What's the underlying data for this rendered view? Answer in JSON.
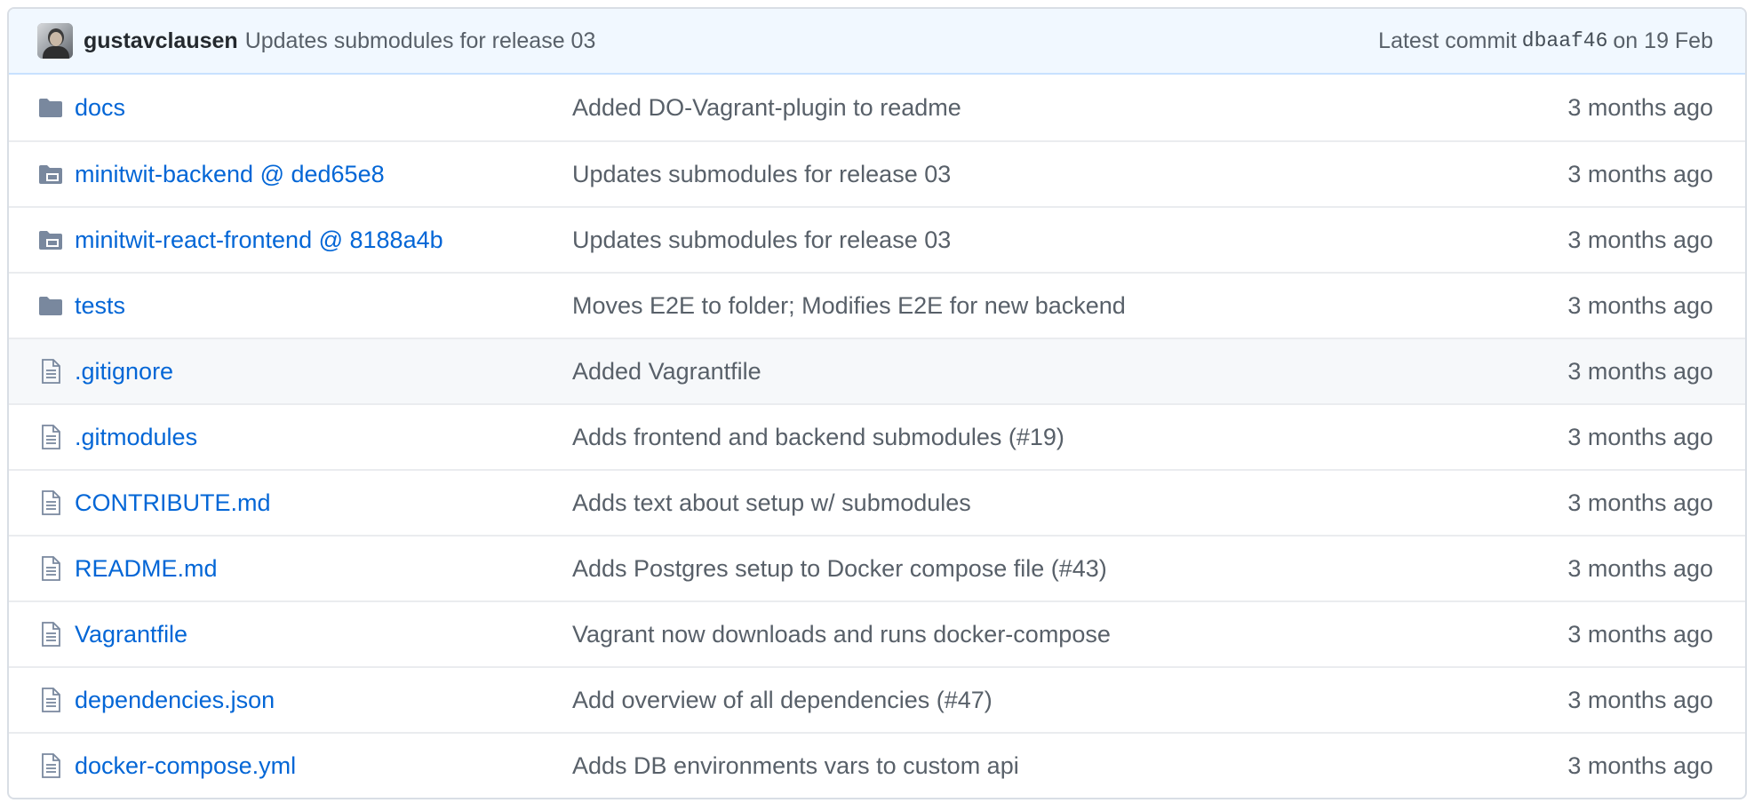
{
  "commit": {
    "author": "gustavclausen",
    "message": "Updates submodules for release 03",
    "latest_label": "Latest commit",
    "sha": "dbaaf46",
    "date": "on 19 Feb"
  },
  "colors": {
    "link": "#0366d6",
    "muted": "#586069",
    "icon": "#79889e",
    "header_bg": "#f1f8ff"
  },
  "files": [
    {
      "icon": "folder-icon",
      "name": "docs",
      "message": "Added DO-Vagrant-plugin to readme",
      "age": "3 months ago"
    },
    {
      "icon": "submodule-icon",
      "name": "minitwit-backend @ ded65e8",
      "message": "Updates submodules for release 03",
      "age": "3 months ago"
    },
    {
      "icon": "submodule-icon",
      "name": "minitwit-react-frontend @ 8188a4b",
      "message": "Updates submodules for release 03",
      "age": "3 months ago"
    },
    {
      "icon": "folder-icon",
      "name": "tests",
      "message": "Moves E2E to folder; Modifies E2E for new backend",
      "age": "3 months ago"
    },
    {
      "icon": "file-icon",
      "name": ".gitignore",
      "message": "Added Vagrantfile",
      "age": "3 months ago"
    },
    {
      "icon": "file-icon",
      "name": ".gitmodules",
      "message": "Adds frontend and backend submodules (#19)",
      "age": "3 months ago"
    },
    {
      "icon": "file-icon",
      "name": "CONTRIBUTE.md",
      "message": "Adds text about setup w/ submodules",
      "age": "3 months ago"
    },
    {
      "icon": "file-icon",
      "name": "README.md",
      "message": "Adds Postgres setup to Docker compose file (#43)",
      "age": "3 months ago"
    },
    {
      "icon": "file-icon",
      "name": "Vagrantfile",
      "message": "Vagrant now downloads and runs docker-compose",
      "age": "3 months ago"
    },
    {
      "icon": "file-icon",
      "name": "dependencies.json",
      "message": "Add overview of all dependencies (#47)",
      "age": "3 months ago"
    },
    {
      "icon": "file-icon",
      "name": "docker-compose.yml",
      "message": "Adds DB environments vars to custom api",
      "age": "3 months ago"
    }
  ]
}
